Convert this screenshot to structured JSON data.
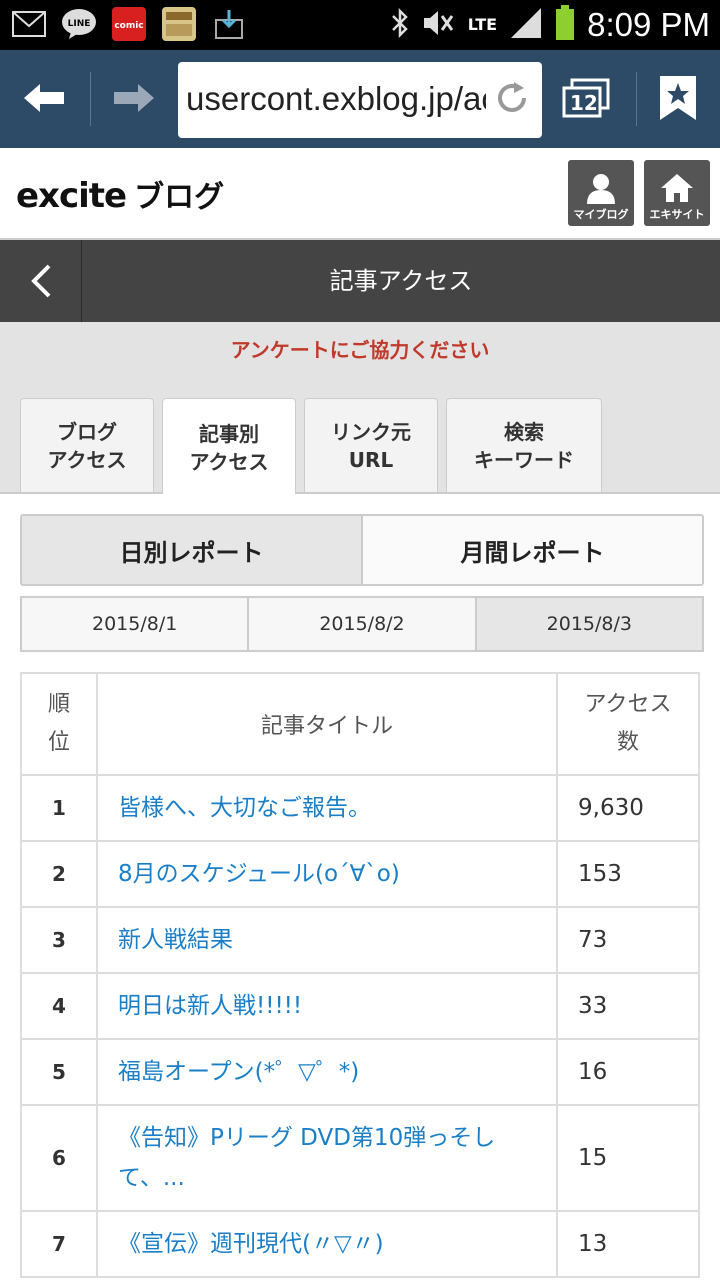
{
  "status_bar": {
    "time": "8:09 PM",
    "network": "LTE",
    "icons": [
      "mail-icon",
      "line-icon",
      "comic-icon",
      "game-icon",
      "download-icon",
      "bluetooth-icon",
      "mute-icon",
      "signal-icon",
      "battery-icon"
    ],
    "line_label": "LINE",
    "comic_label": "comic"
  },
  "browser": {
    "url": "usercont.exblog.jp/ac",
    "tab_count": "12"
  },
  "site_header": {
    "logo_text": "excite",
    "logo_blog": "ブログ",
    "mypage_label": "マイブログ",
    "home_label": "エキサイト"
  },
  "page": {
    "title": "記事アクセス",
    "notice": "アンケートにご協力ください"
  },
  "tabs": [
    {
      "line1": "ブログ",
      "line2": "アクセス",
      "active": false
    },
    {
      "line1": "記事別",
      "line2": "アクセス",
      "active": true
    },
    {
      "line1": "リンク元",
      "line2": "URL",
      "active": false
    },
    {
      "line1": "検索",
      "line2": "キーワード",
      "active": false
    }
  ],
  "report_toggle": {
    "daily": "日別レポート",
    "monthly": "月間レポート"
  },
  "dates": [
    "2015/8/1",
    "2015/8/2",
    "2015/8/3"
  ],
  "table": {
    "headers": {
      "rank_line1": "順",
      "rank_line2": "位",
      "title": "記事タイトル",
      "count_line1": "アクセス",
      "count_line2": "数"
    },
    "rows": [
      {
        "rank": "1",
        "title": "皆様へ、大切なご報告。",
        "count": "9,630"
      },
      {
        "rank": "2",
        "title": "8月のスケジュール(o´∀`o)",
        "count": "153"
      },
      {
        "rank": "3",
        "title": "新人戦結果",
        "count": "73"
      },
      {
        "rank": "4",
        "title": "明日は新人戦!!!!!",
        "count": "33"
      },
      {
        "rank": "5",
        "title": "福島オープン(*゜▽゜*)",
        "count": "16"
      },
      {
        "rank": "6",
        "title": "《告知》Pリーグ DVD第10弾っそして、...",
        "count": "15"
      },
      {
        "rank": "7",
        "title": "《宣伝》週刊現代(〃▽〃)",
        "count": "13"
      }
    ]
  }
}
